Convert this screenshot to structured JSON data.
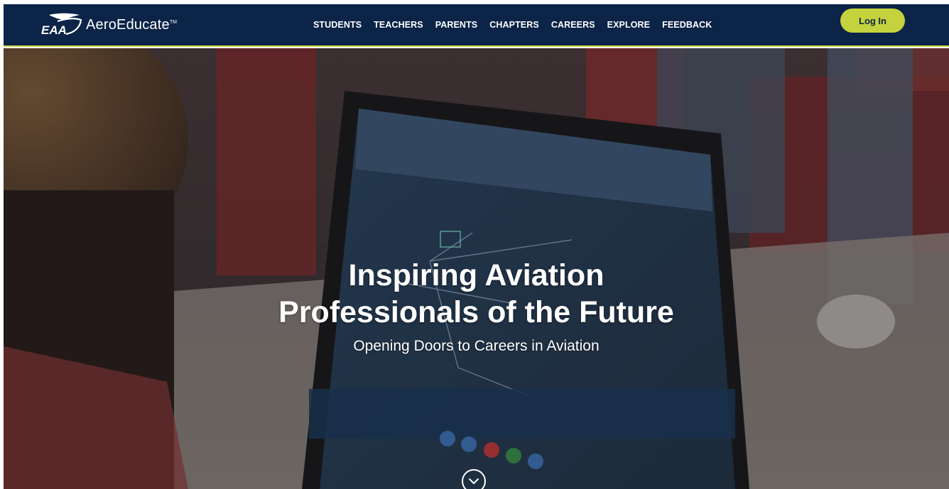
{
  "header": {
    "brand_mark": "EAA",
    "brand_name": "AeroEducate",
    "brand_tm": "TM",
    "nav": [
      {
        "label": "STUDENTS"
      },
      {
        "label": "TEACHERS"
      },
      {
        "label": "PARENTS"
      },
      {
        "label": "CHAPTERS"
      },
      {
        "label": "CAREERS"
      },
      {
        "label": "EXPLORE"
      },
      {
        "label": "FEEDBACK"
      }
    ],
    "login_label": "Log In"
  },
  "hero": {
    "title_line1": "Inspiring Aviation",
    "title_line2": "Professionals of the Future",
    "subtitle": "Opening Doors to Careers in Aviation",
    "scroll_icon": "chevron-down-circle-icon"
  },
  "colors": {
    "header_bg": "#0b2447",
    "accent": "#c4d23d",
    "text_light": "#ffffff"
  }
}
